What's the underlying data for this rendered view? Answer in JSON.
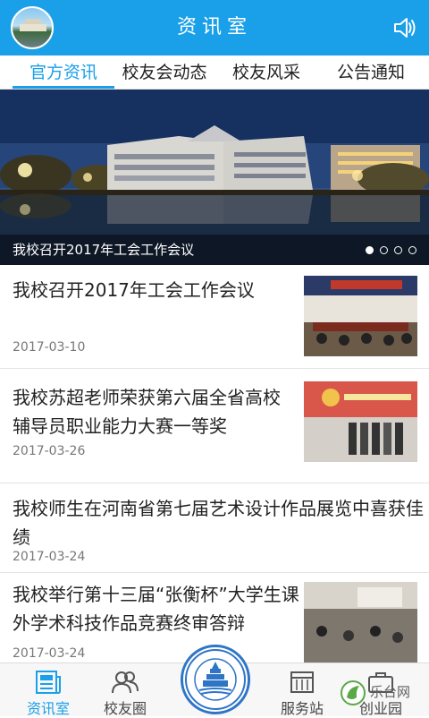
{
  "header": {
    "title": "资讯室",
    "avatar_icon": "campus-avatar-icon",
    "speaker_icon": "speaker-icon",
    "accent_color": "#1aa0e8"
  },
  "tabs": [
    {
      "label": "官方资讯",
      "active": true
    },
    {
      "label": "校友会动态",
      "active": false
    },
    {
      "label": "校友风采",
      "active": false
    },
    {
      "label": "公告通知",
      "active": false
    }
  ],
  "banner": {
    "caption": "我校召开2017年工会工作会议",
    "slide_count": 4,
    "active_slide": 1
  },
  "news": [
    {
      "title": "我校召开2017年工会工作会议",
      "date": "2017-03-10",
      "has_thumb": true
    },
    {
      "title": "我校苏超老师荣获第六届全省高校辅导员职业能力大赛一等奖",
      "date": "2017-03-26",
      "has_thumb": true
    },
    {
      "title": "我校师生在河南省第七届艺术设计作品展览中喜获佳绩",
      "date": "2017-03-24",
      "has_thumb": false
    },
    {
      "title": "我校举行第十三届“张衡杯”大学生课外学术科技作品竞赛终审答辩",
      "date": "2017-03-24",
      "has_thumb": true
    }
  ],
  "bottom_nav": [
    {
      "label": "资讯室",
      "icon": "newspaper-icon",
      "active": true
    },
    {
      "label": "校友圈",
      "icon": "people-icon",
      "active": false
    },
    {
      "label": "",
      "icon": "university-seal-icon",
      "active": false
    },
    {
      "label": "服务站",
      "icon": "building-icon",
      "active": false
    },
    {
      "label": "创业园",
      "icon": "briefcase-icon",
      "active": false
    }
  ],
  "watermark": {
    "text": "乐台网"
  }
}
